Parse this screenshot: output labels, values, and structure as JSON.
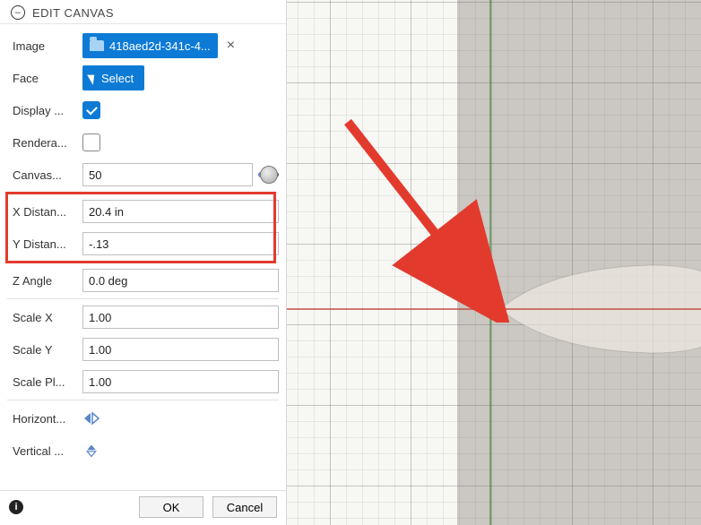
{
  "panel": {
    "title": "EDIT CANVAS",
    "image": {
      "label": "Image",
      "filename": "418aed2d-341c-4..."
    },
    "face": {
      "label": "Face",
      "button": "Select"
    },
    "display": {
      "label": "Display ...",
      "checked": true
    },
    "render": {
      "label": "Rendera..."
    },
    "canvas_opacity": {
      "label": "Canvas...",
      "value": "50",
      "pct": 50
    },
    "x_distance": {
      "label": "X Distan...",
      "value": "20.4 in"
    },
    "y_distance": {
      "label": "Y Distan...",
      "value": "-.13"
    },
    "z_angle": {
      "label": "Z Angle",
      "value": "0.0 deg"
    },
    "scale_x": {
      "label": "Scale X",
      "value": "1.00"
    },
    "scale_y": {
      "label": "Scale Y",
      "value": "1.00"
    },
    "scale_plane": {
      "label": "Scale Pl...",
      "value": "1.00"
    },
    "flip_h": {
      "label": "Horizont..."
    },
    "flip_v": {
      "label": "Vertical ..."
    },
    "ok": "OK",
    "cancel": "Cancel"
  }
}
